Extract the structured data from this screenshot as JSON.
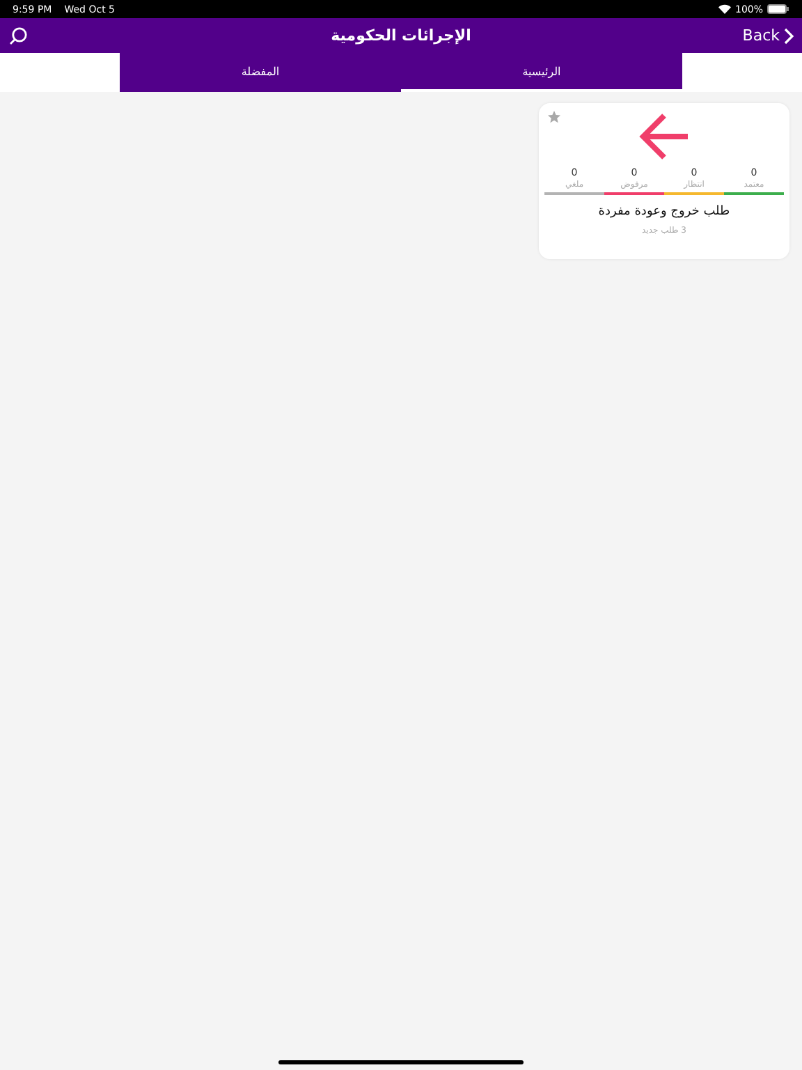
{
  "status_bar": {
    "time": "9:59 PM",
    "date": "Wed Oct 5",
    "battery": "100%"
  },
  "nav": {
    "title": "الإجرائات الحكومية",
    "back": "Back"
  },
  "tabs": [
    {
      "label": "الرئيسية",
      "selected": true
    },
    {
      "label": "المفضلة",
      "selected": false
    }
  ],
  "cards": [
    {
      "favorite": false,
      "title": "طلب خروج وعودة مفردة",
      "subtitle": "3 طلب جديد",
      "stats": [
        {
          "count": "0",
          "label": "معتمد",
          "color": "#3cae4c"
        },
        {
          "count": "0",
          "label": "انتظار",
          "color": "#f5b82e"
        },
        {
          "count": "0",
          "label": "مرفوض",
          "color": "#f03e6a"
        },
        {
          "count": "0",
          "label": "ملغي",
          "color": "#b3b3b3"
        }
      ]
    }
  ]
}
